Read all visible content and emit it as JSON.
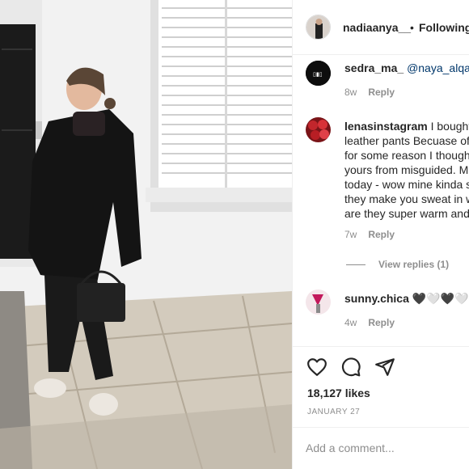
{
  "post": {
    "author": "nadiaanya__",
    "separator": "•",
    "follow_label": "Following",
    "likes": "18,127 likes",
    "date": "JANUARY 27",
    "add_comment_placeholder": "Add a comment..."
  },
  "comments": [
    {
      "user": "sedra_ma_",
      "mention": "@naya_alqad",
      "lines": [],
      "time": "8w",
      "reply_label": "Reply"
    },
    {
      "user": "lenasinstagram",
      "first": "I bought",
      "lines": [
        "leather pants Becuase of",
        "for some reason I though",
        "yours from misguided. M",
        "today - wow mine kinda s",
        "they make you sweat in w",
        "are they super warm and"
      ],
      "time": "7w",
      "reply_label": "Reply",
      "view_replies": "View replies (1)"
    },
    {
      "user": "sunny.chica",
      "hearts": "🖤🤍🖤🤍",
      "lines": [],
      "time": "4w",
      "reply_label": "Reply"
    }
  ],
  "icons": {
    "like": "heart-icon",
    "comment": "comment-icon",
    "share": "share-icon"
  },
  "colors": {
    "text": "#262626",
    "muted": "#8e8e8e",
    "link": "#00376b",
    "border": "#efefef"
  }
}
